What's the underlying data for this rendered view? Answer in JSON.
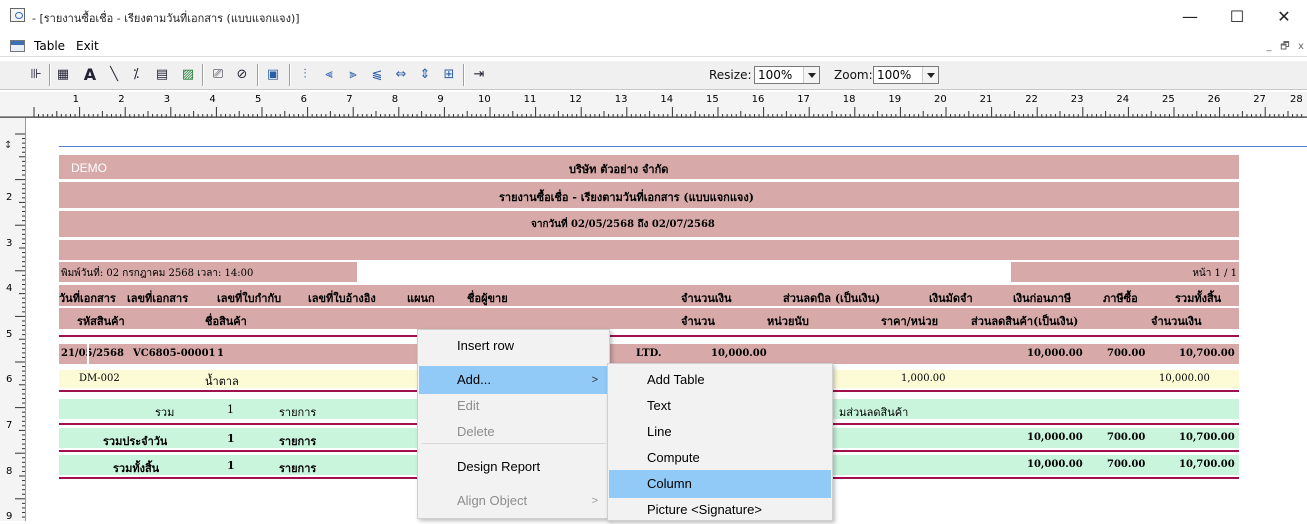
{
  "window": {
    "title": "- [รายงานซื้อเชื่อ - เรียงตามวันที่เอกสาร (แบบแจกแจง)]",
    "minimize": "—",
    "maximize": "☐",
    "close": "✕"
  },
  "menubar": {
    "items": [
      "Table",
      "Exit"
    ],
    "mdi_min": "_",
    "mdi_restore": "🗗",
    "mdi_close": "x"
  },
  "toolbar": {
    "resize_label": "Resize:",
    "resize_value": "100%",
    "zoom_label": "Zoom:",
    "zoom_value": "100%",
    "icons": [
      "column-select-icon",
      "table-icon",
      "text-tool-icon",
      "line-tool-icon",
      "compute-icon",
      "group-icon",
      "picture-icon",
      "report-icon",
      "ellipse-icon",
      "properties-icon",
      "align-top-icon",
      "align-bottom-icon",
      "align-left-icon",
      "align-right-icon",
      "same-width-icon",
      "same-height-icon",
      "grid-icon",
      "exit-icon"
    ],
    "glyphs": [
      "⊪",
      "▦",
      "A",
      "╲",
      "⁒",
      "▤",
      "▨",
      "⎚",
      "⊘",
      "▣",
      "⫶",
      "⫷",
      "⫸",
      "⫹",
      "⇔",
      "⇕",
      "⊞",
      "⇥"
    ]
  },
  "ruler": {
    "numbers": [
      "1",
      "2",
      "3",
      "4",
      "5",
      "6",
      "7",
      "8",
      "9",
      "10",
      "11",
      "12",
      "13",
      "14",
      "15",
      "16",
      "17",
      "18",
      "19",
      "20",
      "21",
      "22",
      "23",
      "24",
      "25",
      "26",
      "27",
      "28"
    ],
    "left_numbers": [
      "2",
      "3",
      "4",
      "5",
      "6",
      "7",
      "8",
      "9"
    ]
  },
  "report": {
    "watermark": "DEMO",
    "company": "บริษัท ตัวอย่าง จำกัด",
    "title": "รายงานซื้อเชื่อ - เรียงตามวันที่เอกสาร (แบบแจกแจง)",
    "date_range": "จากวันที่ 02/05/2568 ถึง 02/07/2568",
    "printed": "พิมพ์วันที่: 02 กรกฎาคม 2568 เวลา: 14:00",
    "page": "หน้า 1 / 1",
    "headers1": [
      "วันที่เอกสาร",
      "เลขที่เอกสาร",
      "เลขที่ใบกำกับ",
      "เลขที่ใบอ้างอิง",
      "แผนก",
      "ชื่อผู้ขาย",
      "จำนวนเงิน",
      "ส่วนลดบิล (เป็นเงิน)",
      "เงินมัดจำ",
      "เงินก่อนภาษี",
      "ภาษีซื้อ",
      "รวมทั้งสิ้น"
    ],
    "headers2": [
      "รหัสสินค้า",
      "ชื่อสินค้า",
      "จำนวน",
      "หน่วยนับ",
      "ราคา/หน่วย",
      "ส่วนลดสินค้า(เป็นเงิน)",
      "จำนวนเงิน"
    ],
    "row1": {
      "date": "21/05/2568",
      "doc_no": "VC6805-00001",
      "invoice": "1",
      "vendor_tail": "LTD.",
      "amount": "10,000.00",
      "before_tax": "10,000.00",
      "vat": "700.00",
      "total": "10,700.00"
    },
    "row2": {
      "code": "DM-002",
      "name": "น้ำตาล",
      "price": "1,000.00",
      "amount": "10,000.00"
    },
    "sum_row": {
      "label": "รวม",
      "count": "1",
      "unit": "รายการ",
      "tail": "มส่วนลดสินค้า"
    },
    "daily_row": {
      "label": "รวมประจำวัน",
      "count": "1",
      "unit": "รายการ",
      "before_tax": "10,000.00",
      "vat": "700.00",
      "total": "10,700.00"
    },
    "grand_row": {
      "label": "รวมทั้งสิ้น",
      "count": "1",
      "unit": "รายการ",
      "before_tax": "10,000.00",
      "vat": "700.00",
      "total": "10,700.00"
    }
  },
  "context_menu": {
    "items": [
      "Insert row",
      "Add...",
      "Edit",
      "Delete",
      "Design Report",
      "Align Object"
    ],
    "submenu": [
      "Add Table",
      "Text",
      "Line",
      "Compute",
      "Column",
      "Picture <Signature>"
    ]
  }
}
